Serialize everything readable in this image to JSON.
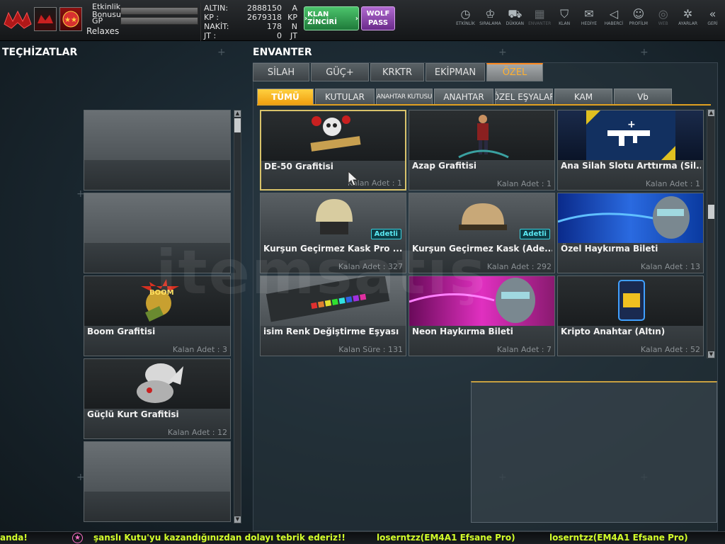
{
  "player": {
    "stat_labels": [
      "Etkinlik Bonusu",
      "GP"
    ],
    "username": "Relaxes",
    "currency": [
      {
        "label": "ALTIN:",
        "value": "2888150",
        "unit": "A"
      },
      {
        "label": "KP  :",
        "value": "2679318",
        "unit": "KP"
      },
      {
        "label": "NAKİT:",
        "value": "178",
        "unit": "N"
      },
      {
        "label": "JT  :",
        "value": "0",
        "unit": "JT"
      }
    ]
  },
  "buttons": {
    "clan_chain": "KLAN ZİNCİRİ",
    "wolf_pass_1": "WOLF",
    "wolf_pass_2": "PASS"
  },
  "topnav": [
    {
      "label": "ETKİNLİK",
      "icon": "stopwatch-icon",
      "glyph": "◷"
    },
    {
      "label": "SIRALAMA",
      "icon": "medal-icon",
      "glyph": "♔"
    },
    {
      "label": "DÜKKAN",
      "icon": "cart-icon",
      "glyph": "⛟"
    },
    {
      "label": "ENVANTER",
      "icon": "inventory-icon",
      "glyph": "▦"
    },
    {
      "label": "KLAN",
      "icon": "clan-shield-icon",
      "glyph": "⛉"
    },
    {
      "label": "HEDİYE",
      "icon": "gift-icon",
      "glyph": "✉"
    },
    {
      "label": "HABERCİ",
      "icon": "megaphone-icon",
      "glyph": "◁"
    },
    {
      "label": "PROFİLM",
      "icon": "profile-icon",
      "glyph": "☺"
    },
    {
      "label": "WEB",
      "icon": "globe-icon",
      "glyph": "◎"
    },
    {
      "label": "AYARLAR",
      "icon": "gear-icon",
      "glyph": "✲"
    },
    {
      "label": "GERİ",
      "icon": "back-chevrons-icon",
      "glyph": "«"
    }
  ],
  "sections": {
    "equipment": "TEÇHİZATLAR",
    "inventory": "ENVANTER"
  },
  "main_tabs": [
    "SİLAH",
    "GÜÇ+",
    "KRKTR",
    "EKİPMAN",
    "ÖZEL"
  ],
  "main_tab_active": "ÖZEL",
  "sub_tabs": [
    "TÜMÜ",
    "KUTULAR",
    "ANAHTAR KUTUSU",
    "ANAHTAR",
    "ÖZEL EŞYALAR",
    "KAM",
    "Vb"
  ],
  "sub_tab_active": "TÜMÜ",
  "left_items": [
    {
      "name": "",
      "count": ""
    },
    {
      "name": "",
      "count": ""
    },
    {
      "name": "Boom Grafitisi",
      "count": "Kalan Adet : 3"
    },
    {
      "name": "Güçlü Kurt Grafitisi",
      "count": "Kalan Adet : 12"
    },
    {
      "name": "",
      "count": ""
    }
  ],
  "grid_items": [
    {
      "name": "DE-50 Grafitisi",
      "count": "Kalan Adet : 1",
      "badge": ""
    },
    {
      "name": "Azap Grafitisi",
      "count": "Kalan Adet : 1",
      "badge": ""
    },
    {
      "name": "Ana Silah Slotu Arttırma (Sil...",
      "count": "Kalan Adet : 1",
      "badge": ""
    },
    {
      "name": "Kurşun Geçirmez Kask Pro ...",
      "count": "Kalan Adet : 327",
      "badge": "Adetli"
    },
    {
      "name": "Kurşun Geçirmez Kask (Ade...",
      "count": "Kalan Adet : 292",
      "badge": "Adetli"
    },
    {
      "name": "Özel Haykırma Bileti",
      "count": "Kalan Adet : 13",
      "badge": ""
    },
    {
      "name": "isim Renk Değiştirme Eşyası",
      "count": "Kalan Süre : 131",
      "badge": ""
    },
    {
      "name": "Neon Haykırma Bileti",
      "count": "Kalan Adet : 7",
      "badge": ""
    },
    {
      "name": "Kripto Anahtar (Altın)",
      "count": "Kalan Adet : 52",
      "badge": ""
    }
  ],
  "ticker": {
    "seg1": "anda!",
    "seg2": "şanslı Kutu'yu kazandığınızdan dolayı tebrik ederiz!!",
    "seg3": "loserntzz(EM4A1 Efsane Pro)",
    "seg4": "loserntzz(EM4A1 Efsane Pro)"
  },
  "watermark": "itemsatış",
  "colors": {
    "accent": "#f0a010",
    "ticker_text": "#d4ff2a",
    "badge": "#3ad2e0"
  }
}
